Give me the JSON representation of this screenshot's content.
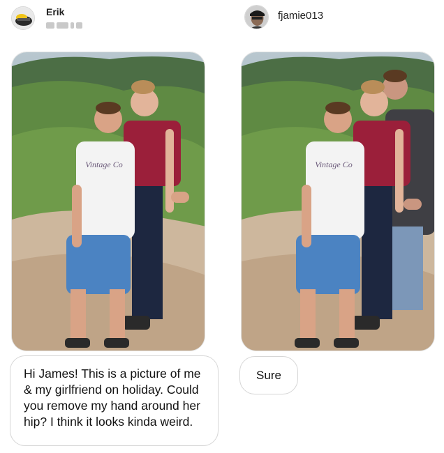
{
  "left_user": {
    "name": "Erik"
  },
  "right_user": {
    "name": "fjamie013"
  },
  "photos": [
    {
      "shirt_text": "Vintage Co"
    },
    {
      "shirt_text": "Vintage Co"
    }
  ],
  "messages": [
    {
      "text": "Hi James! This is a picture of me & my girlfriend on holiday. Could you remove my hand around her hip? I think it looks kinda weird."
    },
    {
      "text": "Sure"
    }
  ]
}
